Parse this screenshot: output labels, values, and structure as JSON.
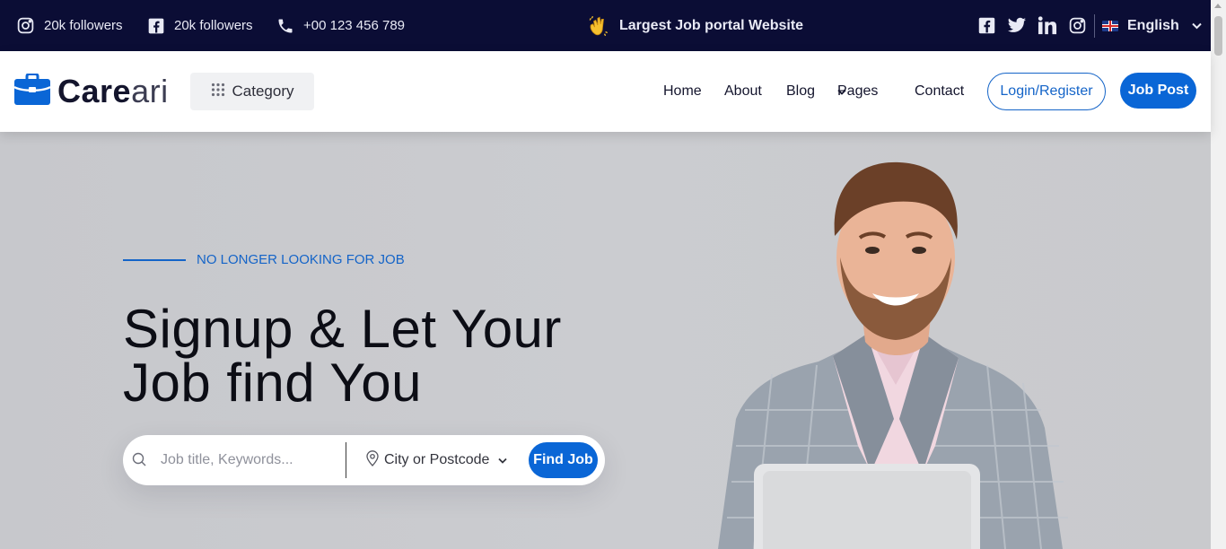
{
  "topbar": {
    "instagram_followers": "20k followers",
    "facebook_followers": "20k followers",
    "phone": "+00 123 456 789",
    "announcement": "Largest Job portal Website",
    "language": "English"
  },
  "nav": {
    "logo_bold": "Care",
    "logo_light": "ari",
    "category": "Category",
    "menu": {
      "home": "Home",
      "about": "About",
      "blog": "Blog",
      "pages": "Pages",
      "contact": "Contact"
    },
    "login": "Login/Register",
    "job_post": "Job Post"
  },
  "hero": {
    "tagline": "NO LONGER LOOKING FOR JOB",
    "headline_line1": "Signup & Let Your",
    "headline_line2": "Job find You",
    "search": {
      "keyword_placeholder": "Job title, Keywords...",
      "location_selected": "City or Postcode",
      "find_button": "Find Job"
    }
  },
  "colors": {
    "topbar_bg": "#0b0d35",
    "accent": "#0a66d6",
    "hero_bg": "#c8c9cd"
  }
}
